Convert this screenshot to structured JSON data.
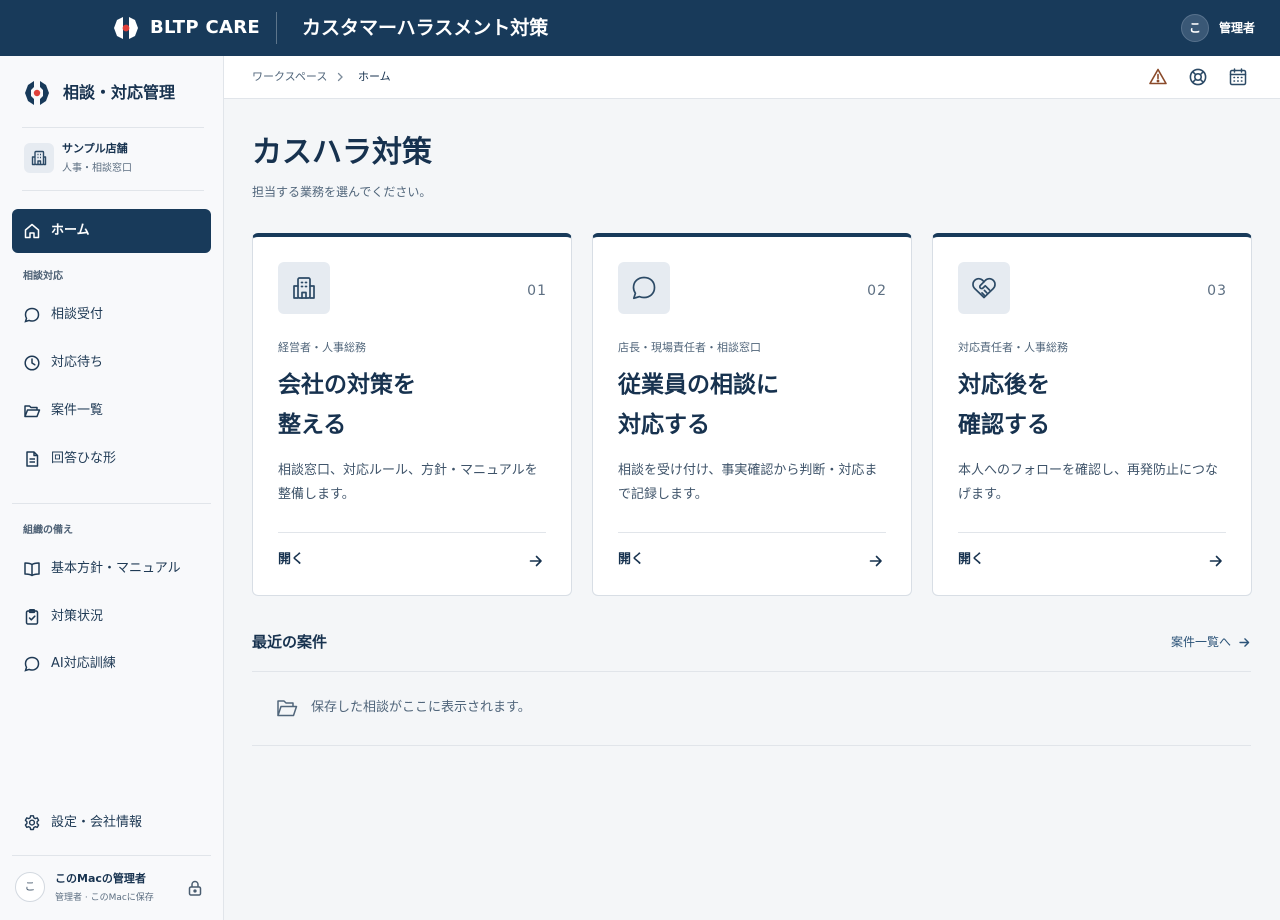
{
  "topbar": {
    "brand": "BLTP CARE",
    "app_title": "カスタマーハラスメント対策",
    "avatar_initial": "こ",
    "user_label": "管理者"
  },
  "sidebar": {
    "title": "相談・対応管理",
    "store": {
      "name": "サンプル店舗",
      "role": "人事・相談窓口"
    },
    "home_label": "ホーム",
    "section_consult": "相談対応",
    "consult_items": [
      {
        "label": "相談受付",
        "icon": "chat-bubble-icon"
      },
      {
        "label": "対応待ち",
        "icon": "clock-icon"
      },
      {
        "label": "案件一覧",
        "icon": "folder-open-icon"
      },
      {
        "label": "回答ひな形",
        "icon": "document-icon"
      }
    ],
    "section_org": "組織の備え",
    "org_items": [
      {
        "label": "基本方針・マニュアル",
        "icon": "book-open-icon"
      },
      {
        "label": "対策状況",
        "icon": "clipboard-check-icon"
      },
      {
        "label": "AI対応訓練",
        "icon": "chat-bubble-icon"
      }
    ],
    "settings_label": "設定・会社情報",
    "user": {
      "initial": "こ",
      "name": "このMacの管理者",
      "meta": "管理者 · このMacに保存"
    }
  },
  "header": {
    "breadcrumb": [
      "ワークスペース",
      "ホーム"
    ],
    "icons": [
      "warning-icon",
      "lifebuoy-icon",
      "calendar-icon"
    ]
  },
  "main": {
    "title": "カスハラ対策",
    "subtitle": "担当する業務を選んでください。",
    "cards": [
      {
        "num": "01",
        "icon": "building-icon",
        "role": "経営者・人事総務",
        "title_line1": "会社の対策を",
        "title_line2": "整える",
        "desc": "相談窓口、対応ルール、方針・マニュアルを整備します。",
        "open_label": "開く"
      },
      {
        "num": "02",
        "icon": "chat-bubble-icon",
        "role": "店長・現場責任者・相談窓口",
        "title_line1": "従業員の相談に",
        "title_line2": "対応する",
        "desc": "相談を受け付け、事実確認から判断・対応まで記録します。",
        "open_label": "開く"
      },
      {
        "num": "03",
        "icon": "heart-handshake-icon",
        "role": "対応責任者・人事総務",
        "title_line1": "対応後を",
        "title_line2": "確認する",
        "desc": "本人へのフォローを確認し、再発防止につなげます。",
        "open_label": "開く"
      }
    ],
    "recent": {
      "title": "最近の案件",
      "link_label": "案件一覧へ",
      "empty_text": "保存した相談がここに表示されます。"
    }
  },
  "colors": {
    "primary": "#183a5a",
    "accent_red": "#e0403a",
    "warning": "#8a4a2a",
    "background": "#f4f6f8"
  }
}
